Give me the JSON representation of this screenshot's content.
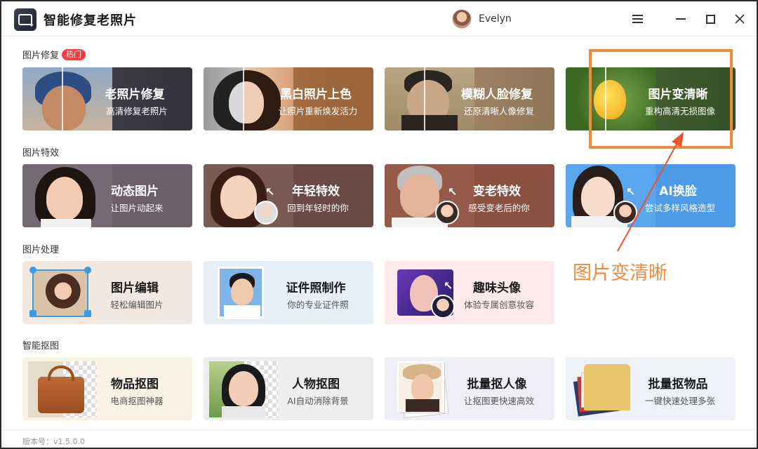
{
  "app": {
    "title": "智能修复老照片"
  },
  "user": {
    "name": "Evelyn"
  },
  "sections": {
    "repair": {
      "label": "图片修复",
      "badge": "热门"
    },
    "effects": {
      "label": "图片特效"
    },
    "processing": {
      "label": "图片处理"
    },
    "cutout": {
      "label": "智能抠图"
    }
  },
  "cards": {
    "old_photo": {
      "title": "老照片修复",
      "sub": "高清修复老照片"
    },
    "colorize": {
      "title": "黑白照片上色",
      "sub": "让照片重新焕发活力"
    },
    "blur_face": {
      "title": "模糊人脸修复",
      "sub": "还原清晰人像修复"
    },
    "enhance": {
      "title": "图片变清晰",
      "sub": "重构高清无损图像"
    },
    "animate": {
      "title": "动态图片",
      "sub": "让图片动起来"
    },
    "younger": {
      "title": "年轻特效",
      "sub": "回到年轻时的你"
    },
    "older": {
      "title": "变老特效",
      "sub": "感受变老后的你"
    },
    "faceswap": {
      "title": "AI换脸",
      "sub": "尝试多样风格造型"
    },
    "edit": {
      "title": "图片编辑",
      "sub": "轻松编辑图片"
    },
    "id_photo": {
      "title": "证件照制作",
      "sub": "你的专业证件照"
    },
    "fun_avatar": {
      "title": "趣味头像",
      "sub": "体验专属创意妆容"
    },
    "object_cut": {
      "title": "物品抠图",
      "sub": "电商抠图神器"
    },
    "person_cut": {
      "title": "人物抠图",
      "sub": "AI自动消除背景"
    },
    "batch_person": {
      "title": "批量抠人像",
      "sub": "让抠图更快速高效"
    },
    "batch_object": {
      "title": "批量抠物品",
      "sub": "一键快速处理多张"
    }
  },
  "annotation": {
    "text": "图片变清晰",
    "color": "#f08a3c"
  },
  "footer": {
    "version": "版本号：v1.5.0.0"
  },
  "colors": {
    "card_old_photo": "#3e3a45",
    "card_colorize": "#a06a3e",
    "card_blur_face": "#9a8060",
    "card_enhance": "#3f5a2c",
    "card_animate": "#6b5f6a",
    "card_younger": "#6a4a44",
    "card_older": "#8a5040",
    "card_faceswap": "#4d9be8",
    "card_edit": "#f2e8e0",
    "card_id_photo": "#e6eef8",
    "card_fun_avatar": "#fde9ec",
    "card_object_cut": "#faf3e4",
    "card_person_cut": "#eeeeee",
    "card_batch_person": "#eeeef6",
    "card_batch_object": "#eef2f8",
    "hot_badge": "#ff3b3b"
  }
}
